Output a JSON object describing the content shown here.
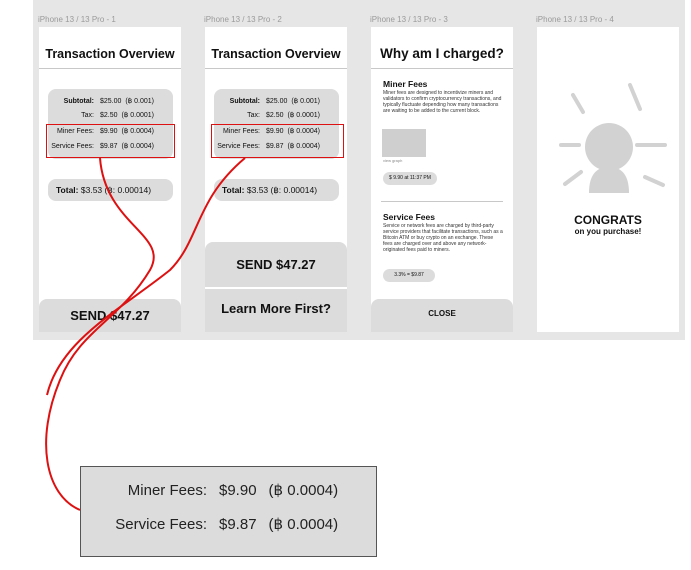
{
  "frames": [
    {
      "label": "iPhone 13 / 13 Pro - 1"
    },
    {
      "label": "iPhone 13 / 13 Pro - 2"
    },
    {
      "label": "iPhone 13 / 13 Pro - 3"
    },
    {
      "label": "iPhone 13 / 13 Pro - 4"
    }
  ],
  "transaction": {
    "title": "Transaction Overview",
    "subtotal_label": "Subtotal:",
    "subtotal_amount": "$25.00",
    "subtotal_btc": "(฿ 0.001)",
    "tax_label": "Tax:",
    "tax_amount": "$2.50",
    "tax_btc": "(฿ 0.0001)",
    "miner_label": "Miner Fees:",
    "miner_amount": "$9.90",
    "miner_btc": "(฿ 0.0004)",
    "service_label": "Service Fees:",
    "service_amount": "$9.87",
    "service_btc": "(฿ 0.0004)",
    "total_label": "Total:",
    "total_value1": "$3.53 (฿: 0.00014)",
    "total_value2": "$3.53 (฿: 0.00014)",
    "send_button1": "SEND $47.27",
    "send_button2": "SEND $47.27",
    "learn_button": "Learn More First?"
  },
  "why": {
    "title": "Why am I charged?",
    "miner_heading": "Miner Fees",
    "miner_text": "Miner fees are designed to incentivize miners and validators to confirm cryptocurrency transactions, and typically fluctuate depending how many transactions are waiting to be added to the current block.",
    "graph_caption": "view graph",
    "miner_pill": "$ 9.90 at 11:37 PM",
    "service_heading": "Service Fees",
    "service_text": "Service or network fees are charged by third-party service providers that facilitate transactions, such as a Bitcoin ATM or buy crypto on an exchange. These fees are charged over and above any network-originated fees paid to miners.",
    "service_pill": "3.3% = $9.87",
    "close_button": "CLOSE"
  },
  "congrats": {
    "title": "CONGRATS",
    "subtitle": "on you purchase!"
  },
  "colors": {
    "highlight": "#d11111",
    "card": "#dcdcdc",
    "canvas": "#e6e6e6"
  }
}
